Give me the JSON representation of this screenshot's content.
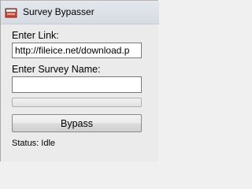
{
  "window": {
    "title": "Survey Bypasser"
  },
  "form": {
    "link_label": "Enter Link:",
    "link_value": "http://fileice.net/download.p",
    "survey_label": "Enter Survey Name:",
    "survey_value": "",
    "progress": 0,
    "bypass_label": "Bypass",
    "status_text": "Status: Idle"
  }
}
